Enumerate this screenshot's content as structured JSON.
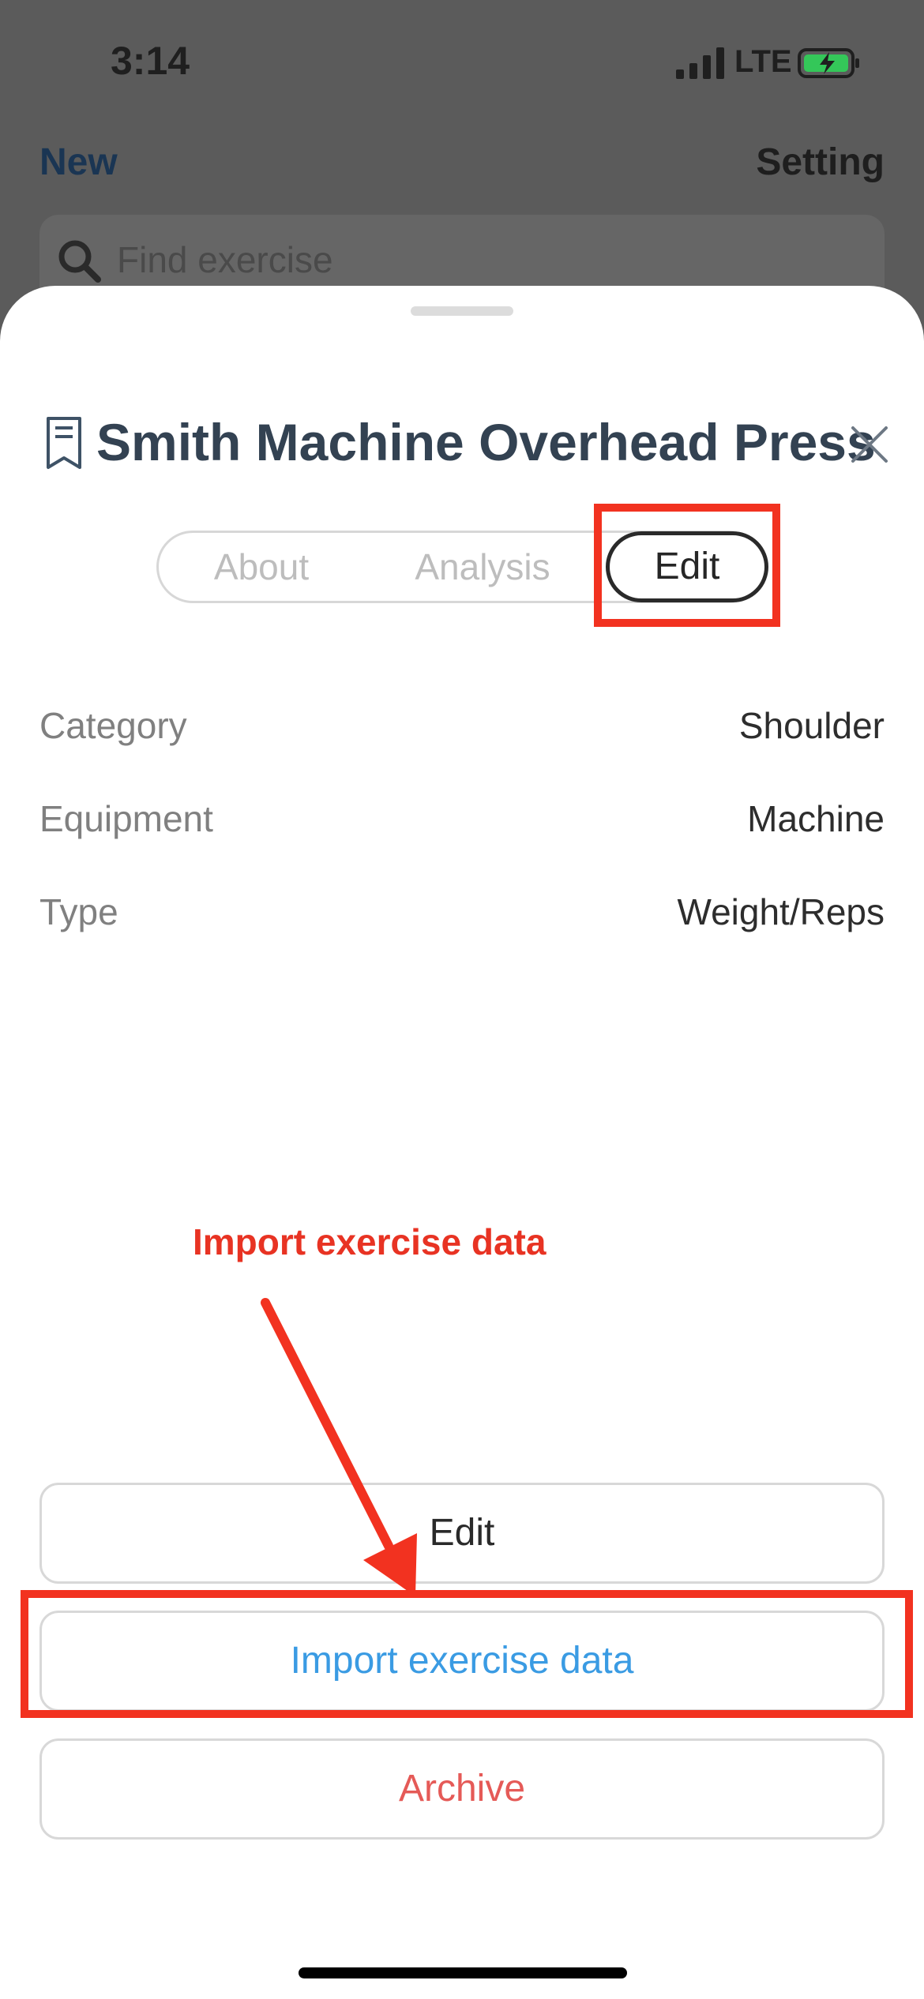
{
  "status_bar": {
    "time": "3:14",
    "network": "LTE"
  },
  "background": {
    "nav_left": "New",
    "nav_right": "Setting",
    "search_placeholder": "Find exercise"
  },
  "sheet": {
    "title": "Smith Machine Overhead Press",
    "tabs": [
      {
        "label": "About",
        "selected": false
      },
      {
        "label": "Analysis",
        "selected": false
      },
      {
        "label": "Edit",
        "selected": true
      }
    ],
    "details": [
      {
        "label": "Category",
        "value": "Shoulder"
      },
      {
        "label": "Equipment",
        "value": "Machine"
      },
      {
        "label": "Type",
        "value": "Weight/Reps"
      }
    ],
    "buttons": {
      "edit": "Edit",
      "import": "Import exercise data",
      "archive": "Archive"
    }
  },
  "annotation": {
    "label": "Import exercise data",
    "color": "#f23220"
  },
  "colors": {
    "accent_blue": "#3a9be3",
    "destructive_red": "#e55a57",
    "title": "#334252"
  }
}
